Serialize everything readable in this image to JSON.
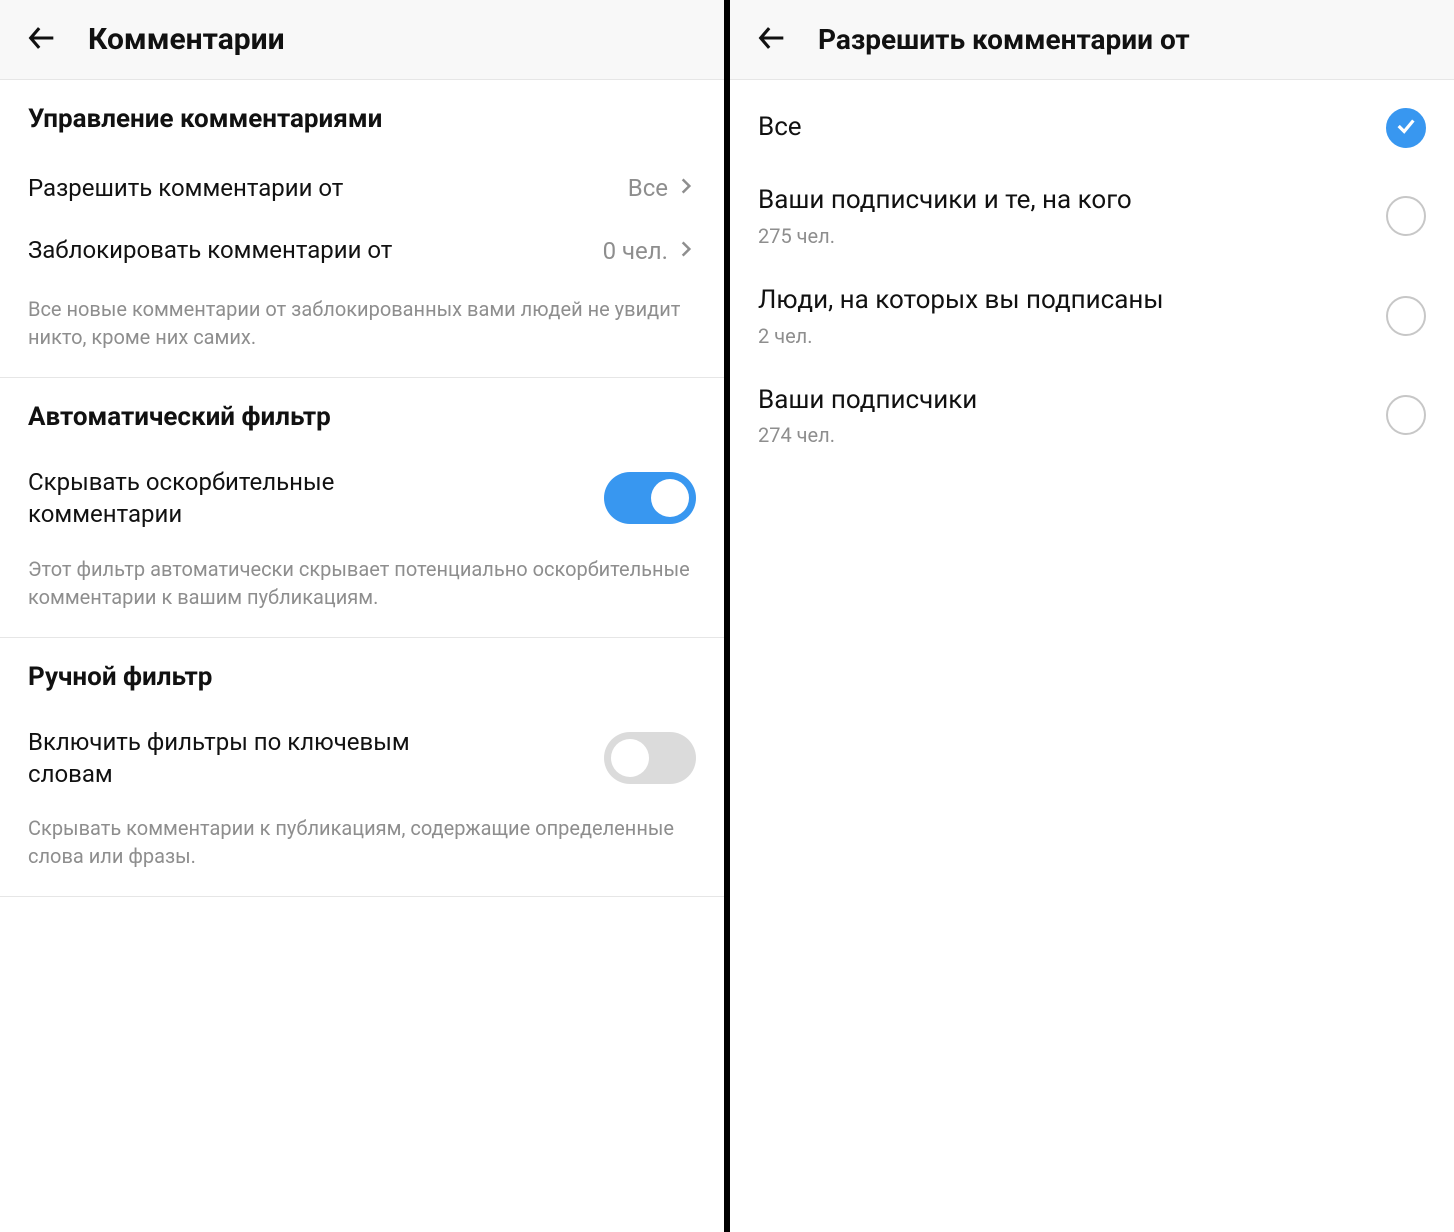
{
  "left": {
    "header_title": "Комментарии",
    "sections": {
      "controls": {
        "title": "Управление комментариями",
        "allow_label": "Разрешить комментарии от",
        "allow_value": "Все",
        "block_label": "Заблокировать комментарии от",
        "block_value": "0 чел.",
        "description": "Все новые комментарии от заблокированных вами людей не увидит никто, кроме них самих."
      },
      "auto_filter": {
        "title": "Автоматический фильтр",
        "hide_label": "Скрывать оскорбительные комментарии",
        "hide_on": true,
        "description": "Этот фильтр автоматически скрывает потенциально оскорбительные комментарии к вашим публикациям."
      },
      "manual_filter": {
        "title": "Ручной фильтр",
        "keyword_label": "Включить фильтры по ключевым словам",
        "keyword_on": false,
        "description": "Скрывать комментарии к публикациям, содержащие определенные слова или фразы."
      }
    }
  },
  "right": {
    "header_title": "Разрешить комментарии от",
    "options": [
      {
        "title": "Все",
        "sub": "",
        "selected": true
      },
      {
        "title": "Ваши подписчики и те, на кого",
        "sub": "275 чел.",
        "selected": false
      },
      {
        "title": "Люди, на которых вы подписаны",
        "sub": "2 чел.",
        "selected": false
      },
      {
        "title": "Ваши подписчики",
        "sub": "274 чел.",
        "selected": false
      }
    ]
  }
}
